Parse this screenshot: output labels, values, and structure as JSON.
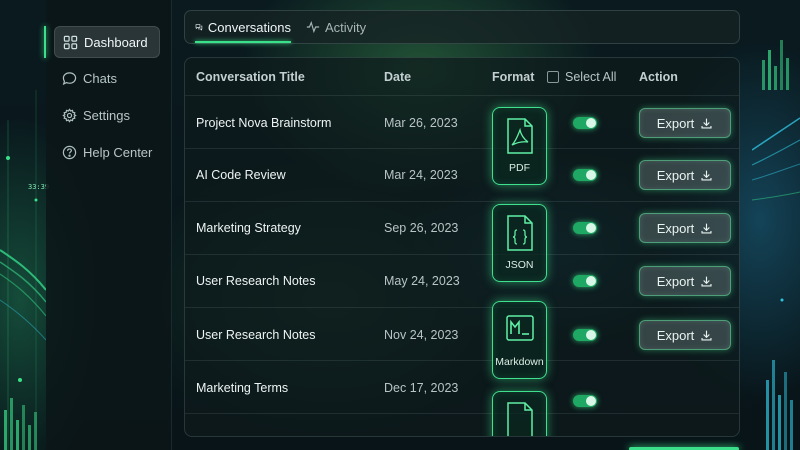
{
  "sidebar": {
    "items": [
      {
        "label": "Dashboard",
        "icon": "grid-icon",
        "active": true
      },
      {
        "label": "Chats",
        "icon": "chat-bubble-icon",
        "active": false
      },
      {
        "label": "Settings",
        "icon": "gear-icon",
        "active": false
      },
      {
        "label": "Help Center",
        "icon": "help-circle-icon",
        "active": false
      }
    ]
  },
  "tabs": [
    {
      "label": "Conversations",
      "icon": "conversations-icon",
      "active": true
    },
    {
      "label": "Activity",
      "icon": "activity-pulse-icon",
      "active": false
    }
  ],
  "table": {
    "headers": {
      "title": "Conversation Title",
      "date": "Date",
      "format": "Format",
      "select_all": "Select All",
      "action": "Action"
    },
    "export_label": "Export",
    "rows": [
      {
        "title": "Project Nova Brainstorm",
        "date": "Mar 26, 2023",
        "selected": true,
        "has_export": true
      },
      {
        "title": "AI Code Review",
        "date": "Mar 24, 2023",
        "selected": true,
        "has_export": true
      },
      {
        "title": "Marketing Strategy",
        "date": "Sep 26, 2023",
        "selected": true,
        "has_export": true
      },
      {
        "title": "User Research Notes",
        "date": "May 24, 2023",
        "selected": true,
        "has_export": true
      },
      {
        "title": "User Research Notes",
        "date": "Nov 24, 2023",
        "selected": true,
        "has_export": true
      },
      {
        "title": "Marketing Terms",
        "date": "Dec 17, 2023",
        "selected": true,
        "has_export": false
      }
    ],
    "formats": [
      {
        "label": "PDF",
        "icon": "pdf-file-icon"
      },
      {
        "label": "JSON",
        "icon": "json-file-icon"
      },
      {
        "label": "Markdown",
        "icon": "markdown-file-icon"
      },
      {
        "label": "",
        "icon": "file-icon"
      }
    ]
  },
  "decor": {
    "left_clock": "33:39"
  },
  "colors": {
    "accent": "#3be08a",
    "background": "#071318",
    "panel": "#0e1a1c"
  }
}
